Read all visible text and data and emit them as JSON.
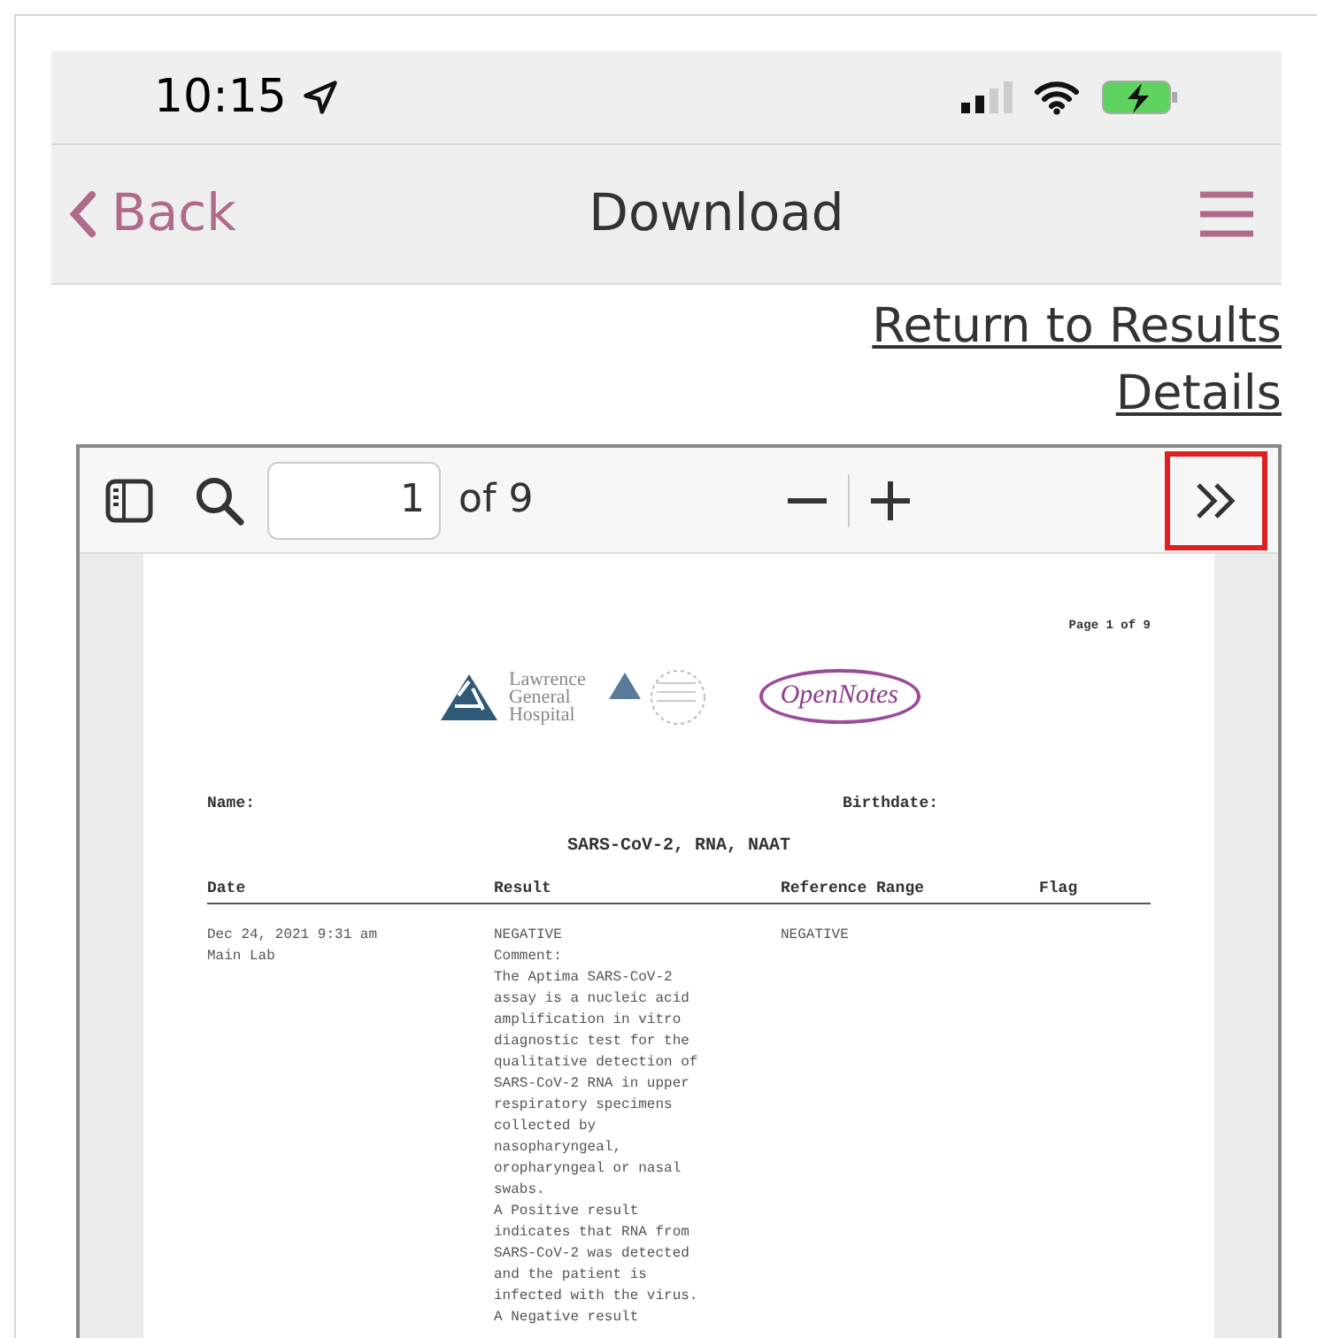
{
  "status_bar": {
    "time": "10:15"
  },
  "nav": {
    "back": "Back",
    "title": "Download"
  },
  "links": [
    "Return to Results",
    "Details"
  ],
  "pdf_toolbar": {
    "page_value": "1",
    "page_count": "of 9",
    "more_highlighted": true
  },
  "document": {
    "page_label": "Page 1 of 9",
    "logos": {
      "hospital": [
        "Lawrence",
        "General",
        "Hospital"
      ],
      "notes": "OpenNotes"
    },
    "name_label": "Name:",
    "birthdate_label": "Birthdate:",
    "test_title": "SARS-CoV-2, RNA, NAAT",
    "columns": [
      "Date",
      "Result",
      "Reference Range",
      "Flag"
    ],
    "row": {
      "date": [
        "Dec 24, 2021 9:31 am",
        "Main Lab"
      ],
      "result": [
        "NEGATIVE",
        "Comment:",
        "The Aptima SARS-CoV-2",
        "assay is a nucleic acid",
        "amplification in vitro",
        "diagnostic test for the",
        "qualitative detection of",
        "SARS-CoV-2 RNA in upper",
        "respiratory specimens",
        "collected by",
        "nasopharyngeal,",
        "oropharyngeal or nasal",
        "swabs.",
        "A Positive result",
        "indicates that RNA from",
        "SARS-CoV-2 was detected",
        "and the patient is",
        "infected with the virus.",
        "A Negative result"
      ],
      "reference": "NEGATIVE"
    }
  }
}
